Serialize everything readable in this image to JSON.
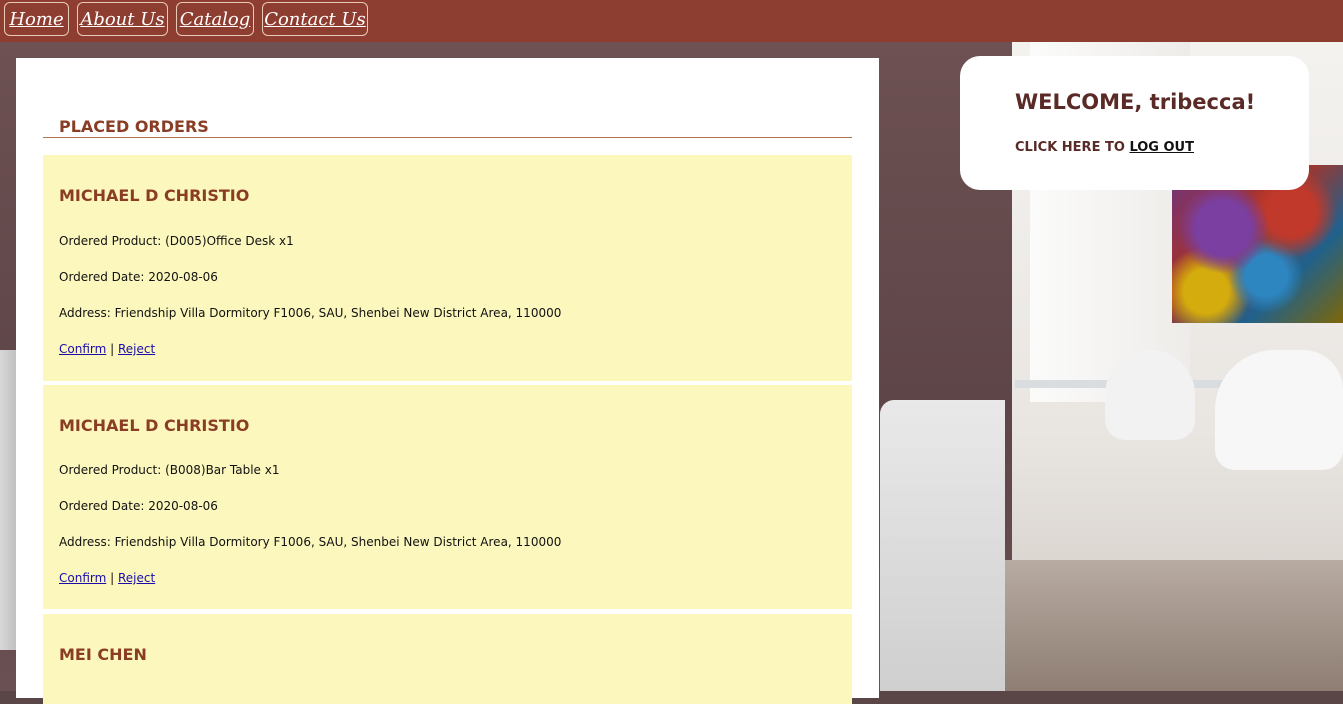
{
  "nav": {
    "items": [
      {
        "label": "Home"
      },
      {
        "label": "About Us"
      },
      {
        "label": "Catalog"
      },
      {
        "label": "Contact Us"
      }
    ]
  },
  "orders_section": {
    "title": "PLACED ORDERS",
    "confirm_label": "Confirm",
    "separator": "|",
    "reject_label": "Reject",
    "orders": [
      {
        "customer": "MICHAEL D CHRISTIO",
        "product": "Ordered Product: (D005)Office Desk x1",
        "date": "Ordered Date: 2020-08-06",
        "address": "Address: Friendship Villa Dormitory F1006, SAU, Shenbei New District Area, 110000"
      },
      {
        "customer": "MICHAEL D CHRISTIO",
        "product": "Ordered Product: (B008)Bar Table x1",
        "date": "Ordered Date: 2020-08-06",
        "address": "Address: Friendship Villa Dormitory F1006, SAU, Shenbei New District Area, 110000"
      },
      {
        "customer": "MEI CHEN"
      }
    ]
  },
  "welcome": {
    "greeting": "WELCOME, tribecca!",
    "prompt": "CLICK HERE TO",
    "logout_label": "LOG OUT"
  },
  "colors": {
    "nav_bg": "#8e3e31",
    "accent_text": "#8a3d25",
    "order_bg": "#fcf8bd"
  }
}
